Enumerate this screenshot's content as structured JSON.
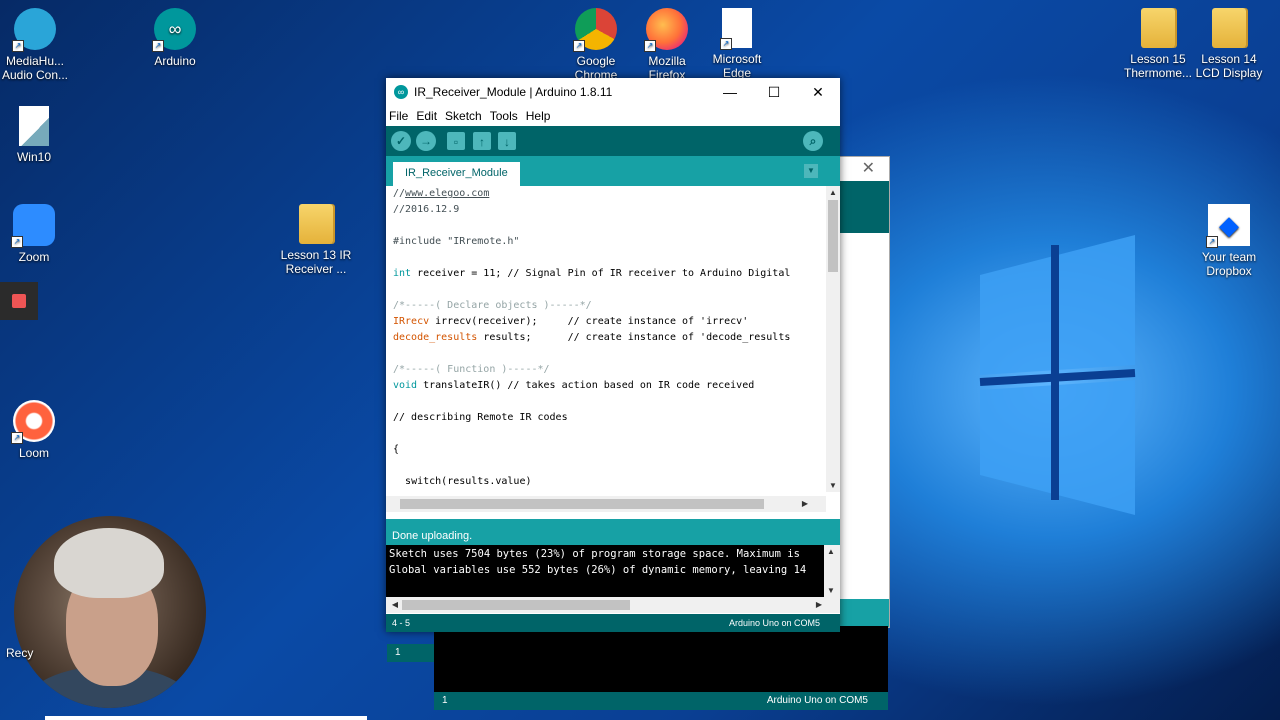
{
  "desktop": {
    "icons": [
      {
        "label": "MediaHu... Audio Con...",
        "icon": "mediahuman-icon"
      },
      {
        "label": "Arduino",
        "icon": "arduino-icon"
      },
      {
        "label": "Google Chrome",
        "icon": "chrome-icon"
      },
      {
        "label": "Mozilla Firefox",
        "icon": "firefox-icon"
      },
      {
        "label": "Microsoft Edge",
        "icon": "file-icon"
      },
      {
        "label": "Lesson 15 Thermome...",
        "icon": "folder-icon"
      },
      {
        "label": "Lesson 14 LCD Display",
        "icon": "folder-icon"
      },
      {
        "label": "Win10",
        "icon": "win10-file-icon"
      },
      {
        "label": "Zoom",
        "icon": "zoom-icon"
      },
      {
        "label": "Lesson 13 IR Receiver ...",
        "icon": "folder-icon"
      },
      {
        "label": "Your team Dropbox",
        "icon": "dropbox-icon"
      },
      {
        "label": "Loom",
        "icon": "loom-icon"
      }
    ],
    "recycle_label": "Recy"
  },
  "window": {
    "title": "IR_Receiver_Module | Arduino 1.8.11",
    "menu": [
      "File",
      "Edit",
      "Sketch",
      "Tools",
      "Help"
    ],
    "tab": "IR_Receiver_Module",
    "toolbar_icons": [
      "verify-icon",
      "upload-icon",
      "new-icon",
      "open-icon",
      "save-icon",
      "serial-monitor-icon"
    ],
    "status_message": "Done uploading.",
    "console": [
      "Sketch uses 7504 bytes (23%) of program storage space. Maximum is",
      "Global variables use 552 bytes (26%) of dynamic memory, leaving 14"
    ],
    "cursor_pos": "4 - 5",
    "board": "Arduino Uno on COM5"
  },
  "code": {
    "l1_prefix": "//",
    "l1_link": "www.elegoo.com",
    "l2": "//2016.12.9",
    "l4_include": "#include",
    "l4_file": " \"IRremote.h\"",
    "l6_kw": "int",
    "l6_rest": " receiver = 11; // Signal Pin of IR receiver to Arduino Digital",
    "l8": "/*-----( Declare objects )-----*/",
    "l9_type": "IRrecv",
    "l9_rest": " irrecv(receiver);     // create instance of 'irrecv'",
    "l10_type": "decode_results",
    "l10_rest": " results;      // create instance of 'decode_results",
    "l12": "/*-----( Function )-----*/",
    "l13_kw": "void",
    "l13_rest": " translateIR() // takes action based on IR code received",
    "l15": "// describing Remote IR codes",
    "l17": "{",
    "l19_kw": "switch",
    "l19_rest": "(results.value)"
  },
  "back_window": {
    "line_number": "1",
    "status_line": "1",
    "board": "Arduino Uno on COM5"
  }
}
